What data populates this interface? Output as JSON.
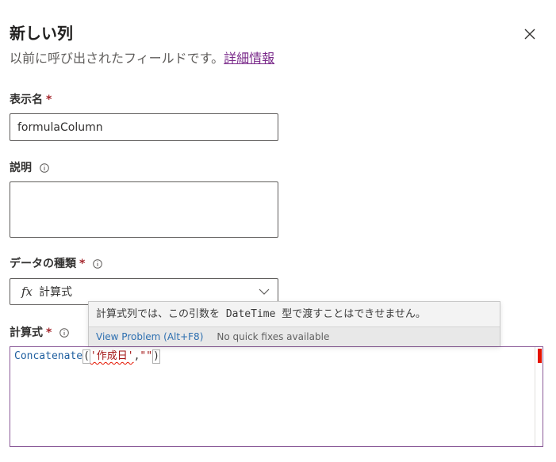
{
  "header": {
    "title": "新しい列",
    "subtitle_text": "以前に呼び出されたフィールドです。",
    "learn_more_link": "詳細情報"
  },
  "fields": {
    "display_name": {
      "label": "表示名",
      "required_mark": "*",
      "value": "formulaColumn"
    },
    "description": {
      "label": "説明",
      "value": ""
    },
    "data_type": {
      "label": "データの種類",
      "required_mark": "*",
      "fx_symbol": "fx",
      "value": "計算式"
    },
    "formula": {
      "label": "計算式",
      "required_mark": "*",
      "code": {
        "function": "Concatenate",
        "open_paren": "(",
        "arg1": "'作成日'",
        "comma": ",",
        "arg2": "\"\"",
        "close_paren": ")"
      }
    }
  },
  "hover_widget": {
    "message": "計算式列では、この引数を DateTime 型で渡すことはできせません。",
    "view_problem": "View Problem (Alt+F8)",
    "no_quick_fixes": "No quick fixes available"
  },
  "colors": {
    "link": "#7a2a8a",
    "required": "#a4262c",
    "error": "#e51400",
    "function": "#1f5f9f"
  },
  "icons": {
    "close": "close-icon",
    "info": "info-icon",
    "chevron": "chevron-down-icon"
  }
}
